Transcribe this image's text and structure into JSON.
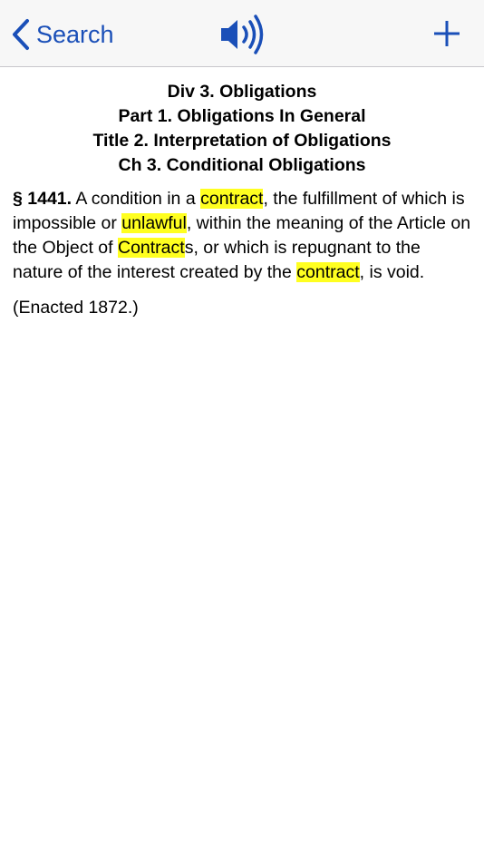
{
  "nav": {
    "back_label": "Search"
  },
  "icons": {
    "back": "chevron-left-icon",
    "speaker": "speaker-icon",
    "add": "plus-icon"
  },
  "colors": {
    "accent": "#1a4fb8",
    "highlight": "#ffff20"
  },
  "headings": [
    "Div 3. Obligations",
    "Part 1. Obligations In General",
    "Title 2. Interpretation of Obligations",
    "Ch 3. Conditional Obligations"
  ],
  "section": {
    "number": "§ 1441.",
    "t1": " A condition in a ",
    "hl1": "contract",
    "t2": ", the fulfillment of which is impossible or ",
    "hl2": "unlawful",
    "t3": ", within the meaning of the Article on the Object of ",
    "hl3": "Contract",
    "t4": "s, or which is repugnant to the nature of the interest created by the ",
    "hl4": "contract",
    "t5": ", is void."
  },
  "enacted": "(Enacted 1872.)"
}
